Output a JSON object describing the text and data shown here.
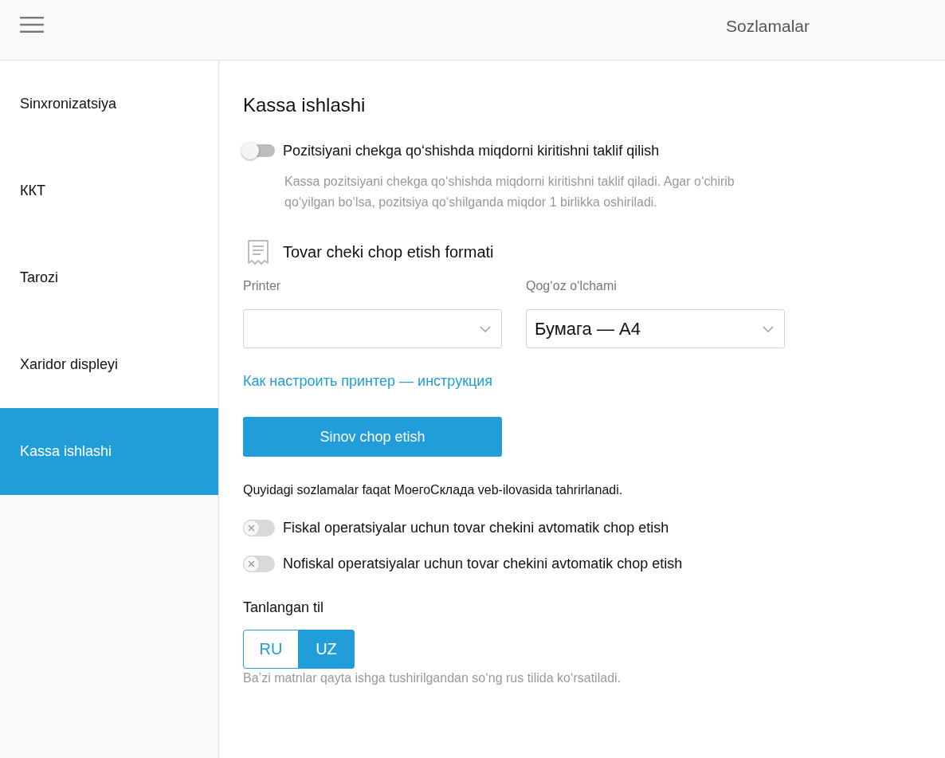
{
  "header": {
    "title": "Sozlamalar"
  },
  "sidebar": {
    "items": [
      {
        "label": "Sinxronizatsiya",
        "selected": false
      },
      {
        "label": "ККТ",
        "selected": false
      },
      {
        "label": "Tarozi",
        "selected": false
      },
      {
        "label": "Xaridor displeyi",
        "selected": false
      },
      {
        "label": "Kassa ishlashi",
        "selected": true
      }
    ]
  },
  "content": {
    "title": "Kassa ishlashi",
    "quantity_prompt": {
      "label": "Pozitsiyani chekga qo‘shishda miqdorni kiritishni taklif qilish",
      "on": false,
      "disabled": false,
      "description": "Kassa pozitsiyani chekga qo‘shishda miqdorni kiritishni taklif qiladi. Agar o‘chirib qo‘yilgan bo‘lsa, pozitsiya qo‘shilganda miqdor 1 birlikka oshiriladi."
    },
    "print_format": {
      "heading": "Tovar cheki chop etish formati",
      "fields": [
        {
          "label": "Printer"
        },
        {
          "label": "Qog‘oz o‘lchami",
          "value": "Бумага — А4"
        }
      ],
      "instruction_link": "Как настроить принтер — инструкция",
      "test_print_button": "Sinov chop etish"
    },
    "note": "Quyidagi sozlamalar faqat МоегоСклада veb-ilovasida tahrirlanadi.",
    "auto_print_toggles": [
      {
        "label": "Fiskal operatsiyalar uchun tovar chekini avtomatik chop etish",
        "on": false,
        "disabled": true
      },
      {
        "label": "Nofiskal operatsiyalar uchun tovar chekini avtomatik chop etish",
        "on": false,
        "disabled": true
      }
    ],
    "language": {
      "label": "Tanlangan til",
      "options": [
        {
          "label": "RU",
          "selected": false
        },
        {
          "label": "UZ",
          "selected": true
        }
      ],
      "hint": "Ba’zi matnlar qayta ishga tushirilgandan so‘ng rus tilida ko‘rsatiladi."
    }
  }
}
